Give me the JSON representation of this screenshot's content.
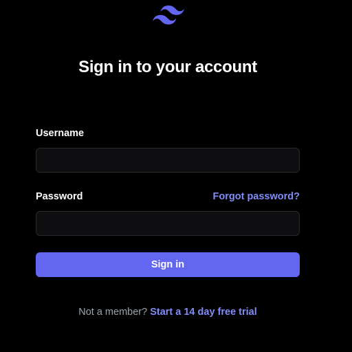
{
  "brand": {
    "logo_icon": "tailwind-wave-icon",
    "accent_color": "#6366f1",
    "link_color": "#818cf8"
  },
  "heading": {
    "title": "Sign in to your account"
  },
  "form": {
    "username": {
      "label": "Username",
      "value": "",
      "placeholder": ""
    },
    "password": {
      "label": "Password",
      "value": "",
      "placeholder": "",
      "forgot_link": "Forgot password?"
    },
    "submit_label": "Sign in"
  },
  "footer": {
    "prompt": "Not a member?",
    "link": "Start a 14 day free trial"
  }
}
